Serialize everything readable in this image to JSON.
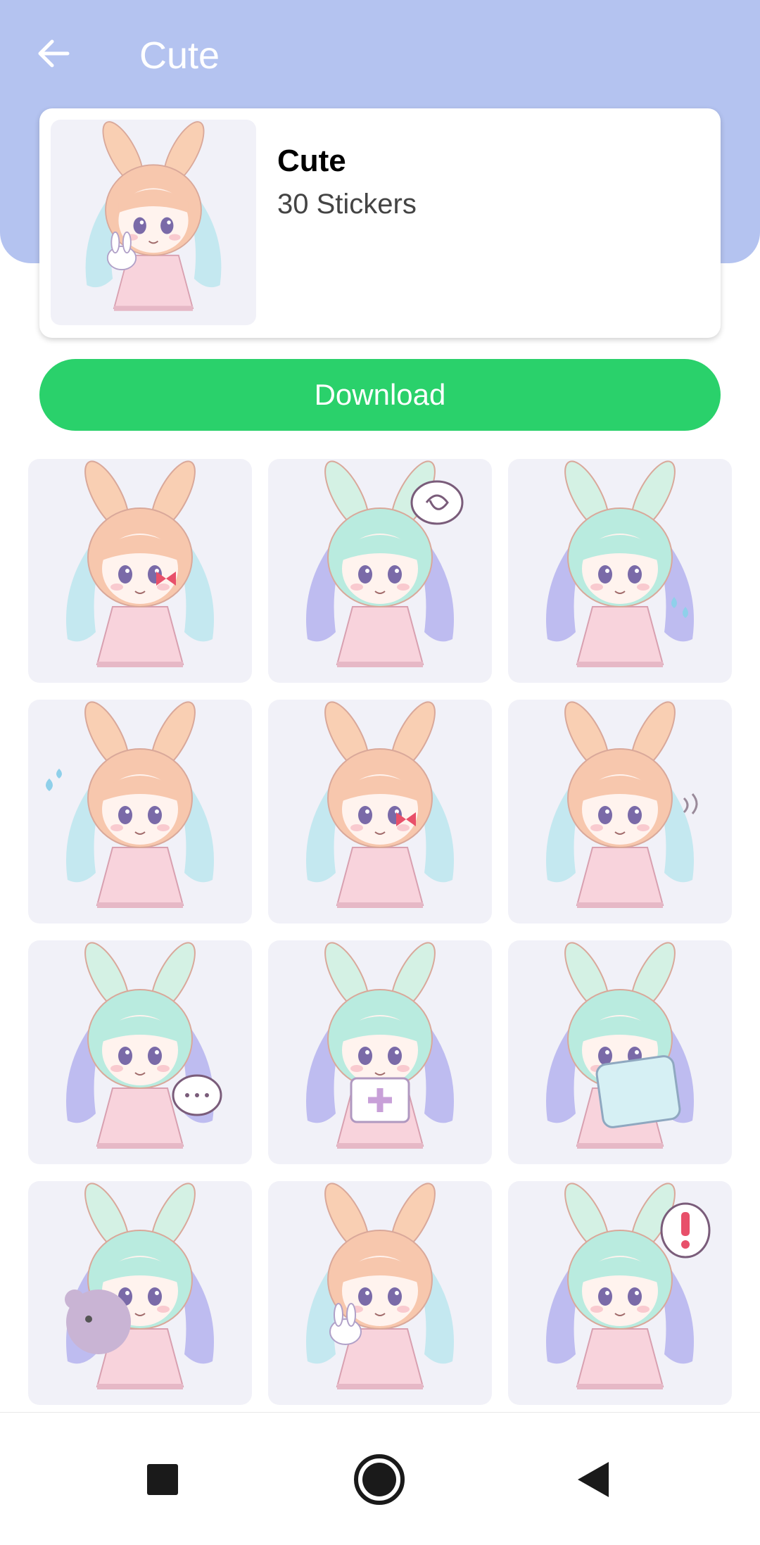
{
  "colors": {
    "header_bg": "#b4c3f0",
    "accent_green": "#2ad16b",
    "tile_bg": "#f1f1f8",
    "nav_icon": "#1a1a1a"
  },
  "header": {
    "title": "Cute",
    "back_icon": "arrow-left-icon"
  },
  "pack": {
    "name": "Cute",
    "count_label": "30 Stickers"
  },
  "download": {
    "label": "Download"
  },
  "stickers": [
    {
      "name": "sticker-1",
      "hair": "peach",
      "accent": "bow"
    },
    {
      "name": "sticker-2",
      "hair": "mint",
      "accent": "speech-swirl"
    },
    {
      "name": "sticker-3",
      "hair": "mint",
      "accent": "tears"
    },
    {
      "name": "sticker-4",
      "hair": "peach",
      "accent": "sweat"
    },
    {
      "name": "sticker-5",
      "hair": "peach",
      "accent": "bow"
    },
    {
      "name": "sticker-6",
      "hair": "peach",
      "accent": "wave"
    },
    {
      "name": "sticker-7",
      "hair": "mint",
      "accent": "speech-dots"
    },
    {
      "name": "sticker-8",
      "hair": "mint",
      "accent": "first-aid"
    },
    {
      "name": "sticker-9",
      "hair": "mint",
      "accent": "pillow"
    },
    {
      "name": "sticker-10",
      "hair": "mint",
      "accent": "bear"
    },
    {
      "name": "sticker-11",
      "hair": "peach",
      "accent": "bunny"
    },
    {
      "name": "sticker-12",
      "hair": "mint",
      "accent": "exclaim"
    }
  ],
  "nav": {
    "recent_icon": "square-icon",
    "home_icon": "circle-icon",
    "back_icon": "triangle-back-icon"
  }
}
